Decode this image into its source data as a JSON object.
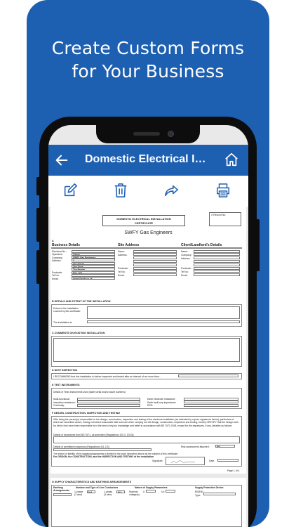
{
  "promo": {
    "headline_line1": "Create Custom Forms",
    "headline_line2": "for Your Business"
  },
  "appbar": {
    "title": "Domestic Electrical In..."
  },
  "form": {
    "cert_title_line1": "DOMESTIC ELECTRICAL INSTALLATION",
    "cert_title_line2": "CERTIFICATE",
    "record_label": "X Record No:",
    "company_name": "SWFY Gas Engineers",
    "section_a": "A",
    "business_details": {
      "heading": "Business Details",
      "labels": [
        "Electrical No.:",
        "Operative:",
        "Company:",
        "Address:",
        "",
        "",
        "",
        "Postcode:",
        "Tel No:",
        "Email:"
      ],
      "values": [
        "",
        "Admin",
        "SWFY Gas Engineers",
        "1",
        "The Street",
        "The Town",
        "The Region",
        "EX1 1XE",
        "",
        "demo@swfy.co.uk"
      ]
    },
    "site_address": {
      "heading": "Site Address",
      "labels": [
        "Name:",
        "Address:",
        "",
        "",
        "",
        "Postcode:",
        "Tel No:",
        "Email:"
      ]
    },
    "client": {
      "heading": "Client/Landlord's Details",
      "labels": [
        "Name:",
        "Company:",
        "Address:",
        "",
        "",
        "Postcode:",
        "Tel No:",
        "Email:"
      ]
    },
    "section_b": "B  DETAILS AND EXTENT OF THE INSTALLATION",
    "extent_label": "Extent of the installation covered by this certificate:",
    "installation_is": "The installation is:",
    "section_c": "C  COMMENTS ON EXISTING INSTALLATION",
    "section_d": "D  NEXT INSPECTION",
    "next_inspection_text": "I RECOMMEND that this installation is further inspected and tested after an interval of not more than :",
    "section_e": "E  TEST INSTRUMENTS",
    "instruments_text": "Details of Tests instruments used (state serial and/or asset numbers)",
    "instrument_labels_left": [
      "Multi-functional:",
      "Insulation resistance:",
      "Continuity:"
    ],
    "instrument_labels_right": [
      "Earth electrode resistance:",
      "Earth fault loop impedance:",
      "RCD:"
    ],
    "section_f": "F  DESIGN, CONSTRUCTION, INSPECTION AND TESTING",
    "design_text": "I/We being the person(s) responsible for the design, construction, inspection and testing of the electrical installation (as indicated by my/our signatures below), particulars of which are described above, having exercised reasonable skill and care when carrying out the design, construction, inspection and testing, hereby CERTIFY that the design work for which I/we have been responsible is to the best of my/our knowledge and belief in accordance with BS 7671:2018, except for the departures, if any, detailed as follows:",
    "departures_label": "Details of departures from BS 7671, as amended (Regulations 120.3, 133.5):",
    "exceptions_label": "Details of permitted exceptions (Regulations 411.3.3):",
    "risk_label": "Risk assessment attached:",
    "risk_value": "N/A",
    "liability_text": "The extent of liability of the signatory/signatories is limited to the work described above as the subject of this certificate",
    "for_design_text": "For DESIGN, the CONSTRUCTION, and the INSPECTION AND TESTING of the installation",
    "signature_label": "Signature:",
    "date_label": "Date:",
    "page_label": "Page 1 of 4",
    "section_g": "G  SUPPLY CHARACTERISTICS AND EARTHING ARRANGEMENTS",
    "supply_headers": [
      "Earthing Arrangements",
      "Number and Type of Live Conductors",
      "Nature of Supply Parameters",
      "Supply Protective Device"
    ],
    "supply_row": [
      "1-phase (2 wire)",
      "N/A",
      "1-phase (3 wire)",
      "N/A",
      "Nominal voltage(s)",
      "U",
      "Uo",
      "BS(EN):",
      "Type:"
    ]
  },
  "icons": {
    "back": "arrow-left-icon",
    "home": "home-icon",
    "edit": "edit-icon",
    "delete": "trash-icon",
    "share": "share-icon",
    "print": "print-icon"
  },
  "colors": {
    "brand_blue": "#1d5fb0",
    "phone_body": "#0d0d0d",
    "paper": "#ffffff",
    "screen_bg": "#e9e9ea"
  }
}
